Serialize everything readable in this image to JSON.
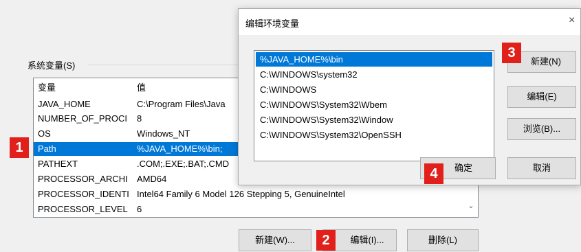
{
  "system_vars": {
    "group_label": "系统变量(S)",
    "header": {
      "name": "变量",
      "value": "值"
    },
    "rows": [
      {
        "name": "JAVA_HOME",
        "value": "C:\\Program Files\\Java"
      },
      {
        "name": "NUMBER_OF_PROCI",
        "value": "8"
      },
      {
        "name": "OS",
        "value": "Windows_NT"
      },
      {
        "name": "Path",
        "value": "%JAVA_HOME%\\bin;"
      },
      {
        "name": "PATHEXT",
        "value": ".COM;.EXE;.BAT;.CMD"
      },
      {
        "name": "PROCESSOR_ARCHI",
        "value": "AMD64"
      },
      {
        "name": "PROCESSOR_IDENTI",
        "value": "Intel64 Family 6 Model 126 Stepping 5, GenuineIntel"
      },
      {
        "name": "PROCESSOR_LEVEL",
        "value": "6"
      }
    ],
    "buttons": {
      "new": "新建(W)...",
      "edit": "编辑(I)...",
      "delete": "删除(L)"
    }
  },
  "edit_dialog": {
    "title": "编辑环境变量",
    "close_glyph": "×",
    "items": [
      "%JAVA_HOME%\\bin",
      "C:\\WINDOWS\\system32",
      "C:\\WINDOWS",
      "C:\\WINDOWS\\System32\\Wbem",
      "C:\\WINDOWS\\System32\\Window",
      "C:\\WINDOWS\\System32\\OpenSSH"
    ],
    "buttons": {
      "new": "新建(N)",
      "edit": "编辑(E)",
      "browse": "浏览(B)...",
      "ok": "确定",
      "cancel": "取消"
    }
  },
  "markers": [
    "1",
    "2",
    "3",
    "4"
  ],
  "colors": {
    "selection": "#0078d7",
    "marker": "#e1201b"
  }
}
